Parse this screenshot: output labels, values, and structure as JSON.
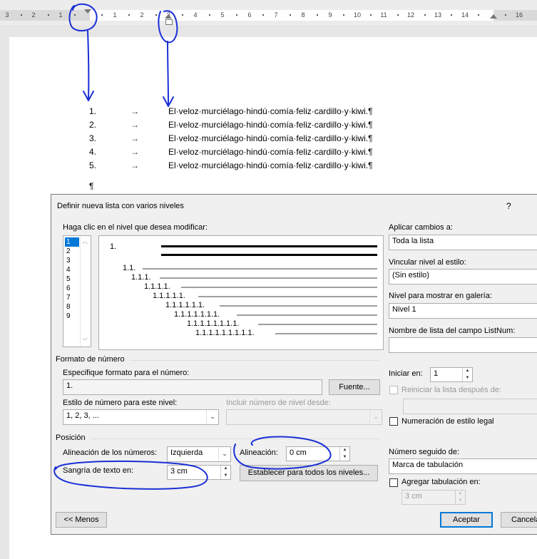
{
  "ruler": {
    "labels": [
      "3",
      "2",
      "1",
      "1",
      "2",
      "3",
      "4",
      "5",
      "6",
      "7",
      "8",
      "9",
      "10",
      "11",
      "12",
      "13",
      "14",
      "16"
    ]
  },
  "document": {
    "items": [
      {
        "num": "1.",
        "arrow": "→",
        "text": "El·veloz·murciélago·hindú·comía·feliz·cardillo·y·kiwi.¶"
      },
      {
        "num": "2.",
        "arrow": "→",
        "text": "El·veloz·murciélago·hindú·comía·feliz·cardillo·y·kiwi.¶"
      },
      {
        "num": "3.",
        "arrow": "→",
        "text": "El·veloz·murciélago·hindú·comía·feliz·cardillo·y·kiwi.¶"
      },
      {
        "num": "4.",
        "arrow": "→",
        "text": "El·veloz·murciélago·hindú·comía·feliz·cardillo·y·kiwi.¶"
      },
      {
        "num": "5.",
        "arrow": "→",
        "text": "El·veloz·murciélago·hindú·comía·feliz·cardillo·y·kiwi.¶"
      }
    ],
    "empty_para": "¶"
  },
  "dialog": {
    "title": "Definir nueva lista con varios niveles",
    "help": "?",
    "level_prompt": "Haga clic en el nivel que desea modificar:",
    "levels": [
      "1",
      "2",
      "3",
      "4",
      "5",
      "6",
      "7",
      "8",
      "9"
    ],
    "selected_level": "1",
    "preview": [
      "1.",
      "1.1.",
      "1.1.1.",
      "1.1.1.1.",
      "1.1.1.1.1.",
      "1.1.1.1.1.1.",
      "1.1.1.1.1.1.1.",
      "1.1.1.1.1.1.1.1.",
      "1.1.1.1.1.1.1.1.1."
    ],
    "apply_label": "Aplicar cambios a:",
    "apply_value": "Toda la lista",
    "link_label": "Vincular nivel al estilo:",
    "link_value": "(Sin estilo)",
    "gallery_label": "Nivel para mostrar en galería:",
    "gallery_value": "Nivel 1",
    "listnum_label": "Nombre de lista del campo ListNum:",
    "listnum_value": "",
    "number_format_section": "Formato de número",
    "format_label": "Especifique formato para el número:",
    "format_value": "1.",
    "font_button": "Fuente...",
    "start_label": "Iniciar en:",
    "start_value": "1",
    "restart_label": "Reiniciar la lista después de:",
    "style_label": "Estilo de número para este nivel:",
    "style_value": "1, 2, 3, ...",
    "include_label": "Incluir número de nivel desde:",
    "include_value": "",
    "legal_label": "Numeración de estilo legal",
    "position_section": "Posición",
    "align_label": "Alineación de los números:",
    "align_value": "Izquierda",
    "alignment_label": "Alineación:",
    "alignment_value": "0 cm",
    "indent_label": "Sangría de texto en:",
    "indent_value": "3 cm",
    "set_all_button": "Establecer para todos los niveles...",
    "followed_label": "Número seguido de:",
    "followed_value": "Marca de tabulación",
    "add_tab_label": "Agregar tabulación en:",
    "add_tab_value": "3 cm",
    "less_button": "<< Menos",
    "ok_button": "Aceptar",
    "cancel_button": "Cancelar"
  },
  "colors": {
    "annotation": "#1a2fd6",
    "accent": "#0078d7"
  }
}
